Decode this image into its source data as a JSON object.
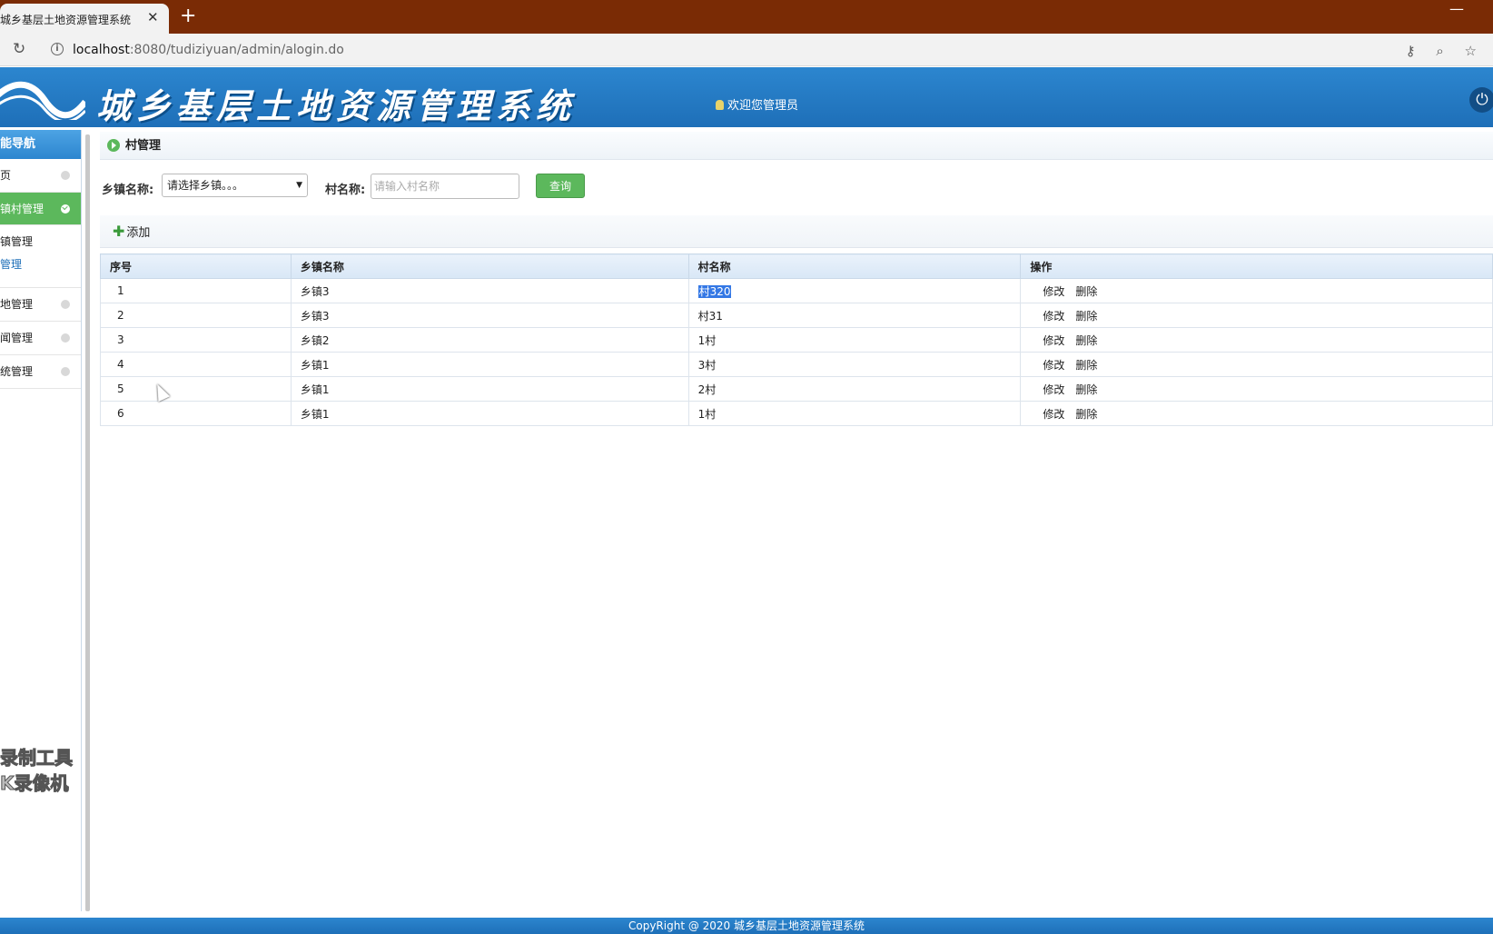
{
  "browser": {
    "tab_title": "城乡基层土地资源管理系统",
    "tab_close": "✕",
    "new_tab": "+",
    "window_minimize": "—",
    "url_host": "localhost",
    "url_rest": ":8080/tudiziyuan/admin/alogin.do"
  },
  "header": {
    "title": "城乡基层土地资源管理系统",
    "welcome": "欢迎您管理员"
  },
  "sidebar": {
    "heading": "能导航",
    "items": [
      {
        "label": "页"
      },
      {
        "label": "镇村管理"
      },
      {
        "label": "地管理"
      },
      {
        "label": "闻管理"
      },
      {
        "label": "统管理"
      }
    ],
    "sub_items": [
      {
        "label": "镇管理"
      },
      {
        "label": "管理"
      }
    ]
  },
  "main": {
    "crumb": "村管理",
    "search": {
      "town_label": "乡镇名称:",
      "town_selected": "请选择乡镇。。。",
      "village_label": "村名称:",
      "village_placeholder": "请输入村名称",
      "query_label": "查询"
    },
    "add_label": "添加",
    "table": {
      "headers": [
        "序号",
        "乡镇名称",
        "村名称",
        "操作"
      ],
      "edit_label": "修改",
      "delete_label": "删除",
      "rows": [
        {
          "seq": "1",
          "town": "乡镇3",
          "village": "村320"
        },
        {
          "seq": "2",
          "town": "乡镇3",
          "village": "村31"
        },
        {
          "seq": "3",
          "town": "乡镇2",
          "village": "1村"
        },
        {
          "seq": "4",
          "town": "乡镇1",
          "village": "3村"
        },
        {
          "seq": "5",
          "town": "乡镇1",
          "village": "2村"
        },
        {
          "seq": "6",
          "town": "乡镇1",
          "village": "1村"
        }
      ]
    }
  },
  "footer": {
    "text": "CopyRight @ 2020 城乡基层土地资源管理系统"
  },
  "watermark": {
    "line1": "录制工具",
    "line2": "K录像机"
  },
  "colors": {
    "tabbar": "#7a2b05",
    "header_blue": "#2c86cf",
    "accent_green": "#5cb85c",
    "selection": "#3478e5"
  }
}
